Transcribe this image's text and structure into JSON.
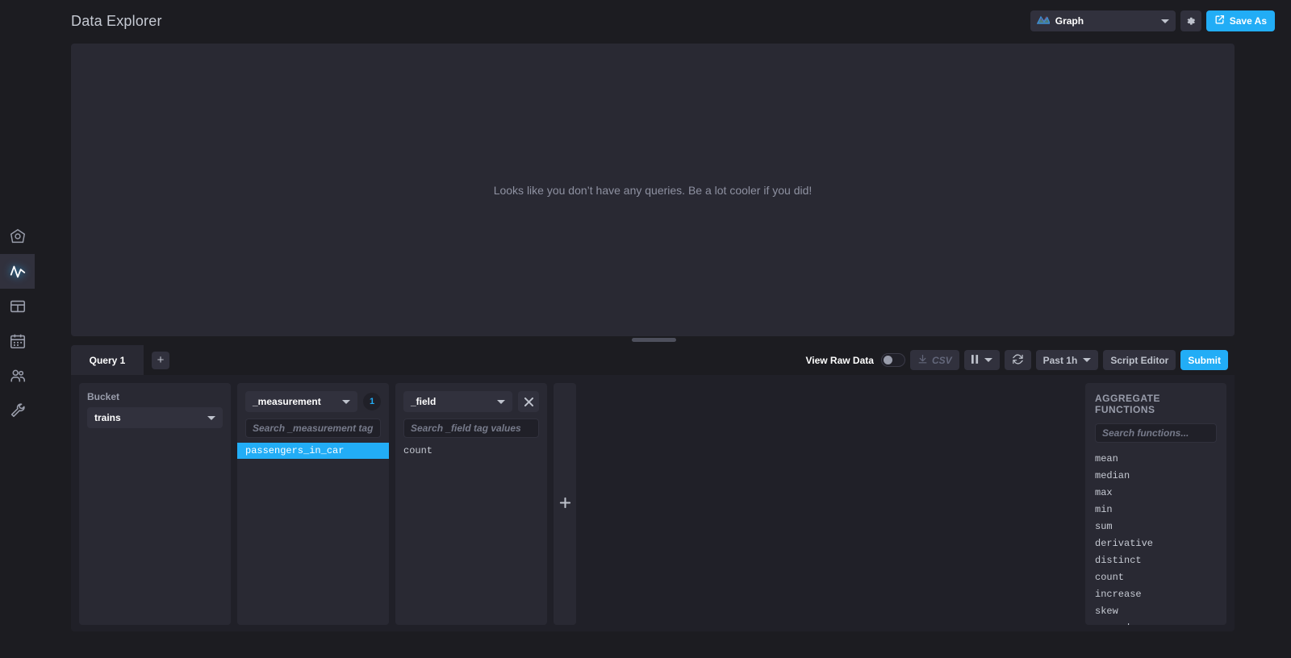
{
  "header": {
    "title": "Data Explorer",
    "viz_selector": {
      "label": "Graph",
      "icon": "area-chart-icon"
    },
    "settings_icon": "gear-icon",
    "save_as_label": "Save As",
    "save_as_icon": "export-icon",
    "accent_color": "#22adf6"
  },
  "nav": {
    "items": [
      {
        "name": "data-icon",
        "label": "Data",
        "active": false
      },
      {
        "name": "explore-icon",
        "label": "Explore",
        "active": true
      },
      {
        "name": "dashboards-icon",
        "label": "Dashboards",
        "active": false
      },
      {
        "name": "tasks-icon",
        "label": "Tasks",
        "active": false
      },
      {
        "name": "organizations-icon",
        "label": "Organizations",
        "active": false
      },
      {
        "name": "settings-wrench-icon",
        "label": "Settings",
        "active": false
      }
    ]
  },
  "graph": {
    "empty_message": "Looks like you don’t have any queries. Be a lot cooler if you did!"
  },
  "query_bar": {
    "tab_label": "Query 1",
    "add_query_label": "+",
    "view_raw_data_label": "View Raw Data",
    "view_raw_data_on": false,
    "csv_label": "CSV",
    "pause_label": "❙❙",
    "refresh_icon": "refresh-icon",
    "time_range_label": "Past 1h",
    "script_editor_label": "Script Editor",
    "submit_label": "Submit"
  },
  "builder": {
    "bucket": {
      "label": "Bucket",
      "selected": "trains"
    },
    "columns": [
      {
        "key_label": "_measurement",
        "count": "1",
        "search_placeholder": "Search _measurement tag values",
        "has_remove": false,
        "values": [
          {
            "text": "passengers_in_car",
            "selected": true
          }
        ]
      },
      {
        "key_label": "_field",
        "count": null,
        "search_placeholder": "Search _field tag values",
        "has_remove": true,
        "remove_icon": "close-icon",
        "values": [
          {
            "text": "count",
            "selected": false
          }
        ]
      }
    ],
    "add_column_label": "+"
  },
  "aggregate": {
    "title": "AGGREGATE FUNCTIONS",
    "search_placeholder": "Search functions...",
    "functions": [
      "mean",
      "median",
      "max",
      "min",
      "sum",
      "derivative",
      "distinct",
      "count",
      "increase",
      "skew",
      "spread"
    ]
  }
}
